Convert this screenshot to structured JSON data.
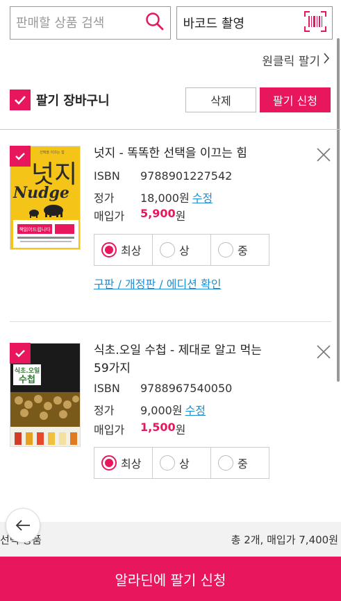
{
  "search": {
    "placeholder": "판매할 상품 검색",
    "barcode_label": "바코드 촬영"
  },
  "oneclick_label": "원클릭 팔기",
  "cart": {
    "title": "팔기 장바구니",
    "delete_label": "삭제",
    "sell_label": "팔기 신청"
  },
  "items": [
    {
      "title": "넛지 - 똑똑한 선택을 이끄는 힘",
      "isbn_label": "ISBN",
      "isbn": "9788901227542",
      "price_label": "정가",
      "price": "18,000원",
      "edit_label": "수정",
      "buy_label": "매입가",
      "buy_value": "5,900",
      "buy_unit": "원",
      "grades": [
        "최상",
        "상",
        "중"
      ],
      "selected_grade": "최상",
      "edition_link": "구판 / 개정판 / 에디션 확인",
      "cover": {
        "top_text": "선택을 이끄는 힘",
        "title_ko": "넛지",
        "title_en": "Nudge",
        "badge": "책읽어드립니다"
      }
    },
    {
      "title": "식초.오일 수첩 - 제대로 알고 먹는 59가지",
      "isbn_label": "ISBN",
      "isbn": "9788967540050",
      "price_label": "정가",
      "price": "9,000원",
      "edit_label": "수정",
      "buy_label": "매입가",
      "buy_value": "1,500",
      "buy_unit": "원",
      "grades": [
        "최상",
        "상",
        "중"
      ],
      "selected_grade": "최상",
      "cover": {
        "title_line1": "식초.오일",
        "title_line2": "수첩"
      }
    }
  ],
  "summary": {
    "left": "선택 상품",
    "right": "총 2개, 매입가 7,400원"
  },
  "submit_label": "알라딘에 팔기 신청",
  "colors": {
    "accent": "#e8175d",
    "link": "#1a8fd8"
  }
}
